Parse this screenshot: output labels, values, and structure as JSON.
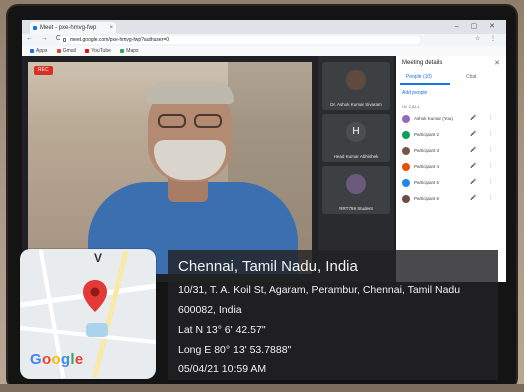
{
  "browser": {
    "tab_title": "Meet - pxe-hmvg-fwp",
    "tab_close": "×",
    "window_controls": "–  ▢  ✕",
    "nav_buttons": "← → C",
    "url": "meet.google.com/pxe-hmvg-fwp?authuser=0",
    "toolbar_right": "☆ ⋮",
    "bookmarks": [
      {
        "label": "Apps",
        "color": "#1a73e8"
      },
      {
        "label": "Gmail",
        "color": "#ea4335"
      },
      {
        "label": "YouTube",
        "color": "#ff0000"
      },
      {
        "label": "Maps",
        "color": "#34a853"
      }
    ]
  },
  "meet": {
    "rec_label": "REC",
    "tiles": [
      {
        "initial": "",
        "name": "Dr. Ashok Kumar Sivaram",
        "avatar_color": "#5f4a3c"
      },
      {
        "initial": "H",
        "name": "Head Kumar Abhishek",
        "avatar_color": "#4a4d52"
      },
      {
        "initial": "",
        "name": "RRT759 Student",
        "avatar_color": "#6a5a7c"
      }
    ],
    "details": {
      "title": "Meeting details",
      "close": "✕",
      "tab_people": "People (10)",
      "tab_chat": "Chat",
      "add_people": "Add people",
      "in_call": "IN CALL",
      "participant_icons": "🎤 ⋮",
      "participants": [
        {
          "name": "Ashok Kumar (You)",
          "color": "#8e6bbf"
        },
        {
          "name": "Participant 2",
          "color": "#0f9d58"
        },
        {
          "name": "Participant 3",
          "color": "#795548"
        },
        {
          "name": "Participant 4",
          "color": "#e65100"
        },
        {
          "name": "Participant 5",
          "color": "#1e88e5"
        },
        {
          "name": "Participant 6",
          "color": "#6d4c41"
        }
      ]
    }
  },
  "geotag": {
    "city": "Chennai, Tamil Nadu, India",
    "address": "10/31, T. A. Koil St, Agaram, Perambur, Chennai, Tamil Nadu",
    "postal": "600082, India",
    "latitude": "Lat N 13° 6' 42.57\"",
    "longitude": "Long E 80° 13' 53.7888\"",
    "datetime": "05/04/21 10:59 AM"
  },
  "map": {
    "label": "V",
    "logo": [
      "G",
      "o",
      "o",
      "g",
      "l",
      "e"
    ]
  },
  "colors": {
    "pin": "#e53935",
    "shirt": "#3c6fb0",
    "overlay": "#222224"
  }
}
